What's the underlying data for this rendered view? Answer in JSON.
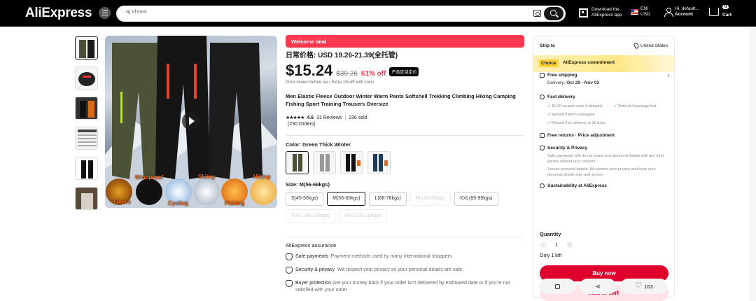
{
  "header": {
    "logo": "AliExpress",
    "search_placeholder": "aj shoes",
    "app_line1": "Download the",
    "app_line2": "AliExpress app",
    "lang_line1": "EN/",
    "lang_line2": "USD",
    "account_line1": "Hi, default...",
    "account_line2": "Account",
    "cart_count": "0",
    "cart_label": "Cart"
  },
  "gallery": {
    "labels": [
      "Windproof",
      "Skiing",
      "Hiking",
      "Fleece",
      "Cycling",
      "Fishing"
    ]
  },
  "product": {
    "deal_banner": "Welcome deal",
    "cn_price": "日常价格: USD 19.26-21.39(全托管)",
    "price": "$15.24",
    "old_price": "$39.26",
    "discount": "61% off",
    "tag": "产品区域定价",
    "tax_note": "Price shown before tax  |  Extra 1% off with coins",
    "title": "Men Elastic Fleece Outdoor Winter Warm Pants Softshell Trekking Climbing Hiking Camping Fishing Sport Training Trousers Oversize",
    "rating": "4.6",
    "reviews": "31 Reviews",
    "sold": "236 sold",
    "orders": "(230 Orders)",
    "color_label": "Color: Green Thick Winter",
    "size_label": "Size: M(56-66kgs)",
    "sizes": [
      "S(45-56kgs)",
      "M(56-66kgs)",
      "L(66-76kgs)",
      "XL(76-85kgs)",
      "XXL(85-95kgs)",
      "XXXL(95-105kgs)",
      "4XL(105-115kgs)"
    ]
  },
  "assurance": {
    "title": "AliExpress assurance",
    "items": [
      {
        "label": "Safe payments",
        "desc": "Payment methods used by many international shoppers"
      },
      {
        "label": "Security & privacy",
        "desc": "We respect your privacy so your personal details are safe"
      },
      {
        "label": "Buyer protection",
        "desc": "Get your money back if your order isn't delivered by estimated date or if you're not satisfied with your order"
      }
    ]
  },
  "panel": {
    "ship_to": "Ship to",
    "location": "United States",
    "choice": "Choice",
    "commitment": "AliExpress commitment",
    "free_shipping": "Free shipping",
    "delivery_prefix": "Delivery:",
    "delivery_dates": "Oct 29 - Nov 02",
    "fast_delivery": "Fast delivery",
    "check1": "$1.00 coupon code if delayed",
    "check2": "Refund if package lost",
    "check3": "Refund if items damaged",
    "check4": "Refund if no delivery in 30 days",
    "free_returns": "Free returns · Price adjustment",
    "security": "Security & Privacy",
    "security_note1": "Safe payments: We do not share your personal details with any third parties without your consent.",
    "security_note2": "Secure personal details: We protect your privacy and keep your personal details safe and secure.",
    "sustainability": "Sustainability at AliExpress",
    "quantity_label": "Quantity",
    "quantity_value": "1",
    "only_left": "Only 1 left",
    "buy_now": "Buy now",
    "add_to_cart": "Add to cart",
    "wishlist_count": "163"
  },
  "colors": {
    "accent": "#e0002c",
    "deal": "#fd384f",
    "choice_yellow": "#ffd235"
  }
}
